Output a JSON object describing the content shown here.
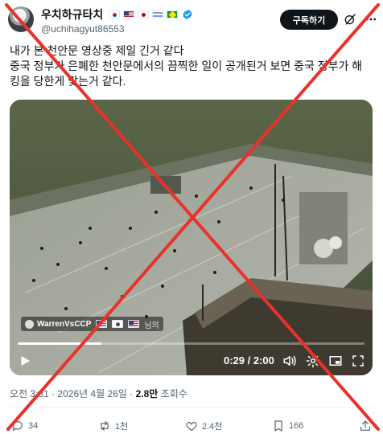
{
  "colors": {
    "accent_red": "#e8322b",
    "text": "#0f1419",
    "muted": "#536471",
    "verified": "#1d9bf0"
  },
  "post": {
    "author": {
      "display_name": "우치하규타치",
      "handle": "@uchihagyut86553",
      "flags": [
        "KR",
        "US",
        "JP",
        "IL",
        "BR"
      ],
      "verified": true
    },
    "subscribe_label": "구독하기",
    "text_lines": [
      "내가 본 천안문 영상중 제일 긴거 같다",
      "중국 정부가 은폐한 천안문에서의 끔찍한 일이 공개된거 보면 중국 정부가 해",
      "킹을 당한게 맞는거 같다."
    ],
    "video": {
      "watermark": "WarrenVsCCP",
      "watermark_suffix": "님의",
      "elapsed": "0:29",
      "duration": "2:00",
      "time_display": "0:29 / 2:00",
      "progress": 0.242
    },
    "meta": {
      "timestamp": "오전 3:31 · 2026년 4월 26일 · ",
      "views_count": "2.8만",
      "views_label": " 조회수"
    },
    "actions": {
      "replies": "34",
      "reposts": "1천",
      "likes": "2.4천",
      "bookmarks": "166"
    }
  }
}
